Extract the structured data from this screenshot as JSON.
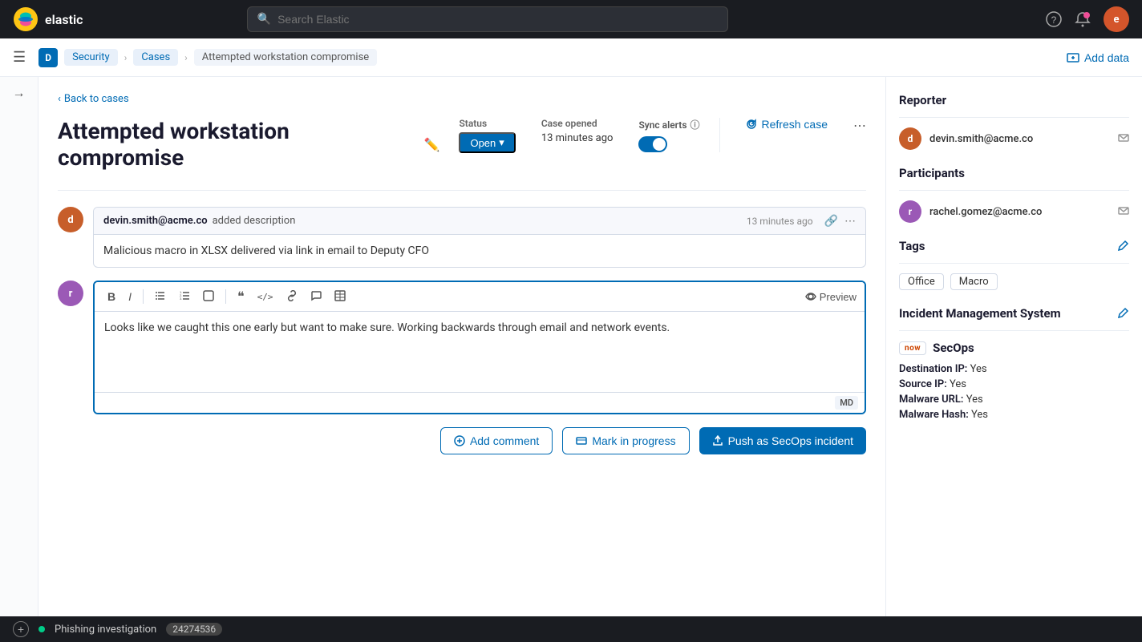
{
  "topnav": {
    "logo_text": "elastic",
    "search_placeholder": "Search Elastic",
    "user_initial": "e"
  },
  "breadcrumb": {
    "badge_label": "D",
    "security_label": "Security",
    "cases_label": "Cases",
    "current_label": "Attempted workstation compromise",
    "add_data_label": "Add data"
  },
  "back_link": "Back to cases",
  "case": {
    "title": "Attempted workstation compromise",
    "status": "Open",
    "status_chevron": "▾",
    "case_opened_label": "Case opened",
    "case_opened_value": "13 minutes ago",
    "sync_alerts_label": "Sync alerts",
    "refresh_label": "Refresh case"
  },
  "comment1": {
    "avatar_label": "d",
    "avatar_color": "#c75e2a",
    "author": "devin.smith@acme.co",
    "action": "added description",
    "time": "13 minutes ago",
    "content": "Malicious macro in XLSX delivered via link in email to Deputy CFO"
  },
  "editor": {
    "content": "Looks like we caught this one early but want to make sure. Working backwards through email and network events.",
    "preview_label": "Preview",
    "md_label": "MD"
  },
  "editor_avatar": {
    "label": "r",
    "color": "#9b59b6"
  },
  "toolbar": {
    "bold": "B",
    "italic": "I",
    "ul": "≡",
    "ol": "⊟",
    "checkbox": "☐",
    "quote": "❝",
    "code": "</>",
    "link": "🔗",
    "comment": "💬",
    "table": "⊞"
  },
  "actions": {
    "mark_in_progress": "Mark in progress",
    "push_incident": "Push as SecOps incident",
    "add_comment": "Add comment"
  },
  "right_panel": {
    "reporter_title": "Reporter",
    "reporter_email": "devin.smith@acme.co",
    "reporter_avatar": "d",
    "reporter_avatar_color": "#c75e2a",
    "participants_title": "Participants",
    "participant_email": "rachel.gomez@acme.co",
    "participant_avatar": "r",
    "participant_avatar_color": "#9b59b6",
    "tags_title": "Tags",
    "tags": [
      "Office",
      "Macro"
    ],
    "ims_title": "Incident Management System",
    "ims_logo": "now",
    "secops_title": "SecOps",
    "fields": [
      {
        "label": "Destination IP:",
        "value": "Yes"
      },
      {
        "label": "Source IP:",
        "value": "Yes"
      },
      {
        "label": "Malware URL:",
        "value": "Yes"
      },
      {
        "label": "Malware Hash:",
        "value": "Yes"
      }
    ]
  },
  "bottom_bar": {
    "tab_label": "Phishing investigation",
    "tab_badge": "24274536"
  }
}
